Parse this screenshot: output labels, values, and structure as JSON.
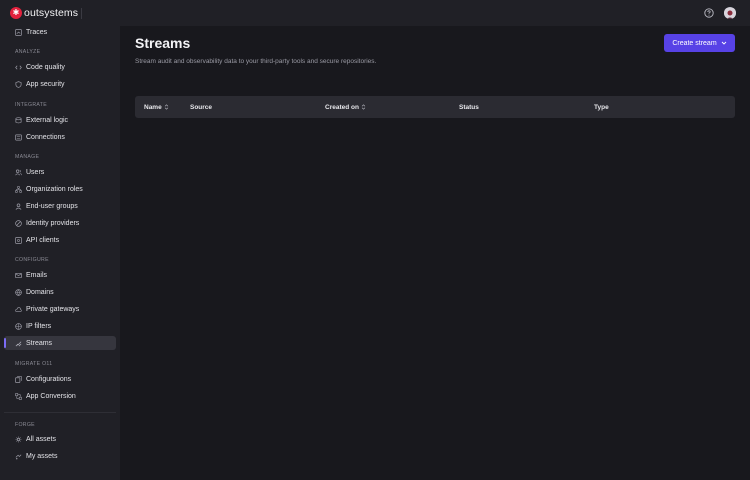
{
  "brand": {
    "name": "outsystems"
  },
  "sidebar": {
    "top_items": [
      {
        "label": "Traces",
        "icon": "traces-icon"
      }
    ],
    "sections": {
      "analyze": {
        "title": "ANALYZE",
        "items": [
          {
            "label": "Code quality"
          },
          {
            "label": "App security"
          }
        ]
      },
      "integrate": {
        "title": "INTEGRATE",
        "items": [
          {
            "label": "External logic"
          },
          {
            "label": "Connections"
          }
        ]
      },
      "manage": {
        "title": "MANAGE",
        "items": [
          {
            "label": "Users"
          },
          {
            "label": "Organization roles"
          },
          {
            "label": "End-user groups"
          },
          {
            "label": "Identity providers"
          },
          {
            "label": "API clients"
          }
        ]
      },
      "configure": {
        "title": "CONFIGURE",
        "items": [
          {
            "label": "Emails"
          },
          {
            "label": "Domains"
          },
          {
            "label": "Private gateways"
          },
          {
            "label": "IP filters"
          },
          {
            "label": "Streams",
            "active": true
          }
        ]
      },
      "migrate": {
        "title": "MIGRATE O11",
        "items": [
          {
            "label": "Configurations"
          },
          {
            "label": "App Conversion"
          }
        ]
      },
      "forge": {
        "title": "FORGE",
        "items": [
          {
            "label": "All assets"
          },
          {
            "label": "My assets"
          }
        ]
      }
    }
  },
  "main": {
    "title": "Streams",
    "subtitle": "Stream audit and observability data to your third-party tools and secure repositories.",
    "create_button": "Create stream",
    "table": {
      "columns": [
        {
          "label": "Name",
          "sortable": true
        },
        {
          "label": "Source",
          "sortable": false
        },
        {
          "label": "Created on",
          "sortable": true
        },
        {
          "label": "Status",
          "sortable": false
        },
        {
          "label": "Type",
          "sortable": false
        }
      ],
      "rows": []
    }
  },
  "colors": {
    "accent": "#5742e6",
    "active_indicator": "#7c6cf6",
    "brand": "#e2213d"
  }
}
